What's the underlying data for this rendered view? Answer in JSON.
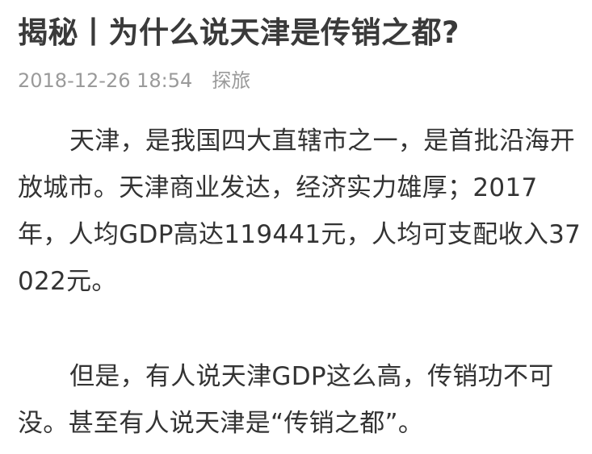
{
  "article": {
    "title": "揭秘丨为什么说天津是传销之都?",
    "date": "2018-12-26 18:54",
    "source": "探旅",
    "paragraphs": [
      "天津，是我国四大直辖市之一，是首批沿海开放城市。天津商业发达，经济实力雄厚；2017年，人均GDP高达119441元，人均可支配收入37022元。",
      "但是，有人说天津GDP这么高，传销功不可没。甚至有人说天津是“传销之都”。"
    ]
  }
}
